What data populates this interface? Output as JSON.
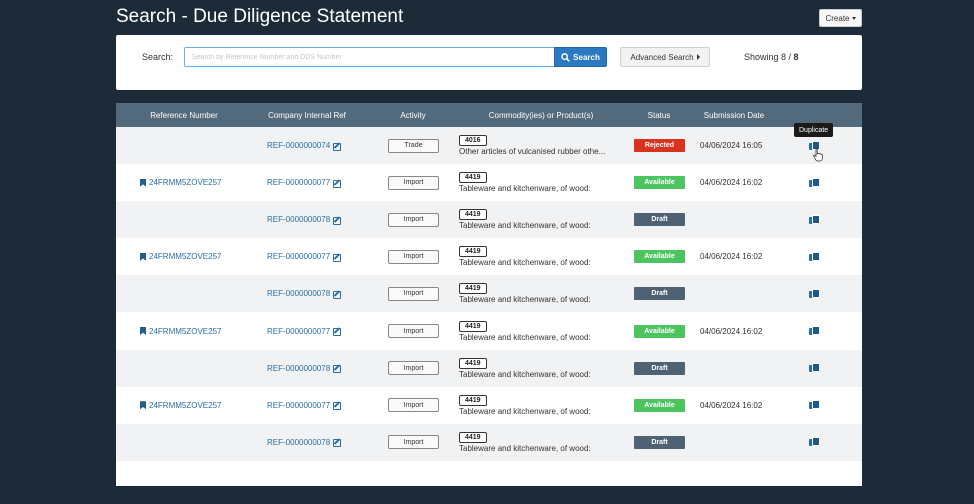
{
  "page": {
    "title": "Search - Due Diligence Statement"
  },
  "toolbar": {
    "create_label": "Create"
  },
  "search": {
    "label": "Search:",
    "placeholder": "Search by Reference Number and DDS Number",
    "button_label": "Search",
    "advanced_label": "Advanced Search",
    "showing_prefix": "Showing 8 /",
    "showing_total": "8"
  },
  "table": {
    "headers": [
      "Reference Number",
      "Company Internal Ref",
      "Activity",
      "Commodity(ies) or Product(s)",
      "Status",
      "Submission Date"
    ],
    "rows": [
      {
        "ref": "",
        "company_ref": "REF-0000000074",
        "activity": "Trade",
        "hs": "4016",
        "desc": "Other articles of vulcanised rubber othe...",
        "status": "Rejected",
        "date": "04/06/2024 16:05"
      },
      {
        "ref": "24FRMM5ZOVE257",
        "company_ref": "REF-0000000077",
        "activity": "Import",
        "hs": "4419",
        "desc": "Tableware and kitchenware, of wood:",
        "status": "Available",
        "date": "04/06/2024 16:02"
      },
      {
        "ref": "",
        "company_ref": "REF-0000000078",
        "activity": "Import",
        "hs": "4419",
        "desc": "Tableware and kitchenware, of wood:",
        "status": "Draft",
        "date": ""
      },
      {
        "ref": "24FRMM5ZOVE257",
        "company_ref": "REF-0000000077",
        "activity": "Import",
        "hs": "4419",
        "desc": "Tableware and kitchenware, of wood:",
        "status": "Available",
        "date": "04/06/2024 16:02"
      },
      {
        "ref": "",
        "company_ref": "REF-0000000078",
        "activity": "Import",
        "hs": "4419",
        "desc": "Tableware and kitchenware, of wood:",
        "status": "Draft",
        "date": ""
      },
      {
        "ref": "24FRMM5ZOVE257",
        "company_ref": "REF-0000000077",
        "activity": "Import",
        "hs": "4419",
        "desc": "Tableware and kitchenware, of wood:",
        "status": "Available",
        "date": "04/06/2024 16:02"
      },
      {
        "ref": "",
        "company_ref": "REF-0000000078",
        "activity": "Import",
        "hs": "4419",
        "desc": "Tableware and kitchenware, of wood:",
        "status": "Draft",
        "date": ""
      },
      {
        "ref": "24FRMM5ZOVE257",
        "company_ref": "REF-0000000077",
        "activity": "Import",
        "hs": "4419",
        "desc": "Tableware and kitchenware, of wood:",
        "status": "Available",
        "date": "04/06/2024 16:02"
      },
      {
        "ref": "",
        "company_ref": "REF-0000000078",
        "activity": "Import",
        "hs": "4419",
        "desc": "Tableware and kitchenware, of wood:",
        "status": "Draft",
        "date": ""
      }
    ]
  },
  "tooltip": {
    "text": "Duplicate"
  },
  "colors": {
    "background": "#1d2b38",
    "header": "#526a7c",
    "link": "#2a6ea5",
    "rejected": "#d9321f",
    "available": "#4cc561",
    "draft": "#4f6273",
    "primary_button": "#2a79c2"
  }
}
